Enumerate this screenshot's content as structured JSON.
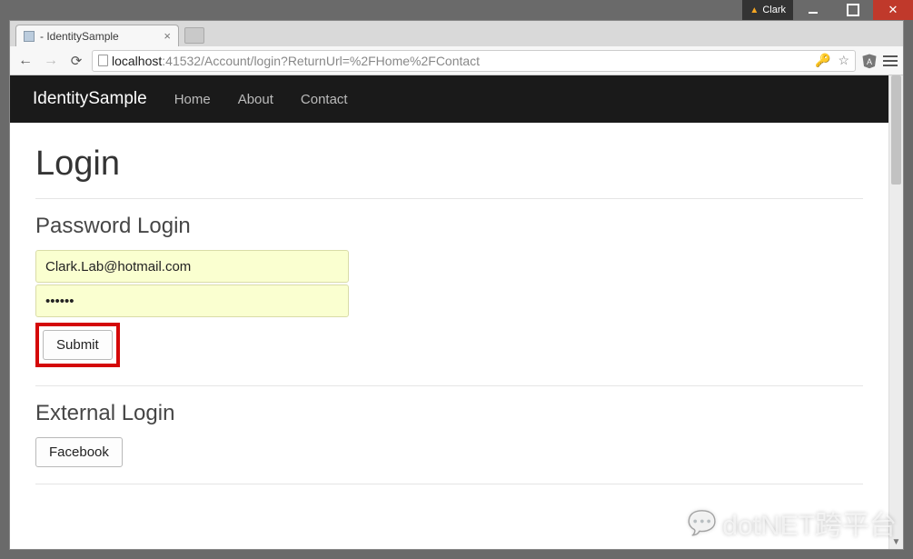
{
  "os": {
    "user_label": "Clark"
  },
  "browser": {
    "tab_title": "- IdentitySample",
    "url_host": "localhost",
    "url_rest": ":41532/Account/login?ReturnUrl=%2FHome%2FContact"
  },
  "navbar": {
    "brand": "IdentitySample",
    "links": [
      "Home",
      "About",
      "Contact"
    ]
  },
  "page": {
    "heading": "Login",
    "password_login_heading": "Password Login",
    "email_value": "Clark.Lab@hotmail.com",
    "password_value_masked": "••••••",
    "submit_label": "Submit",
    "external_login_heading": "External Login",
    "facebook_label": "Facebook"
  },
  "watermark": "dotNET跨平台"
}
